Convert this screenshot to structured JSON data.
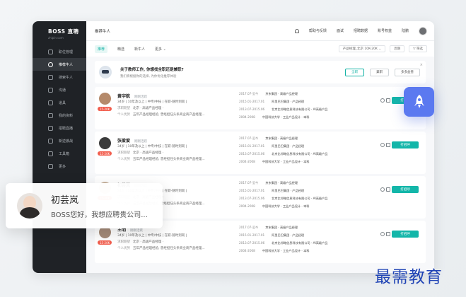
{
  "sidebar": {
    "brand": "BOSS 直聘",
    "brand_sub": "zhipin.com",
    "items": [
      {
        "label": "职位管理"
      },
      {
        "label": "推荐牛人"
      },
      {
        "label": "搜索牛人"
      },
      {
        "label": "沟通"
      },
      {
        "label": "道具"
      },
      {
        "label": "我的资料"
      },
      {
        "label": "招聘直播"
      },
      {
        "label": "新逆袭战"
      },
      {
        "label": "工具箱"
      },
      {
        "label": "更多"
      }
    ]
  },
  "topbar": {
    "title": "推荐牛人",
    "links": [
      "帮助与反馈",
      "面试",
      "招聘数据",
      "账号权益",
      "陆鹏"
    ]
  },
  "tabs": [
    "推荐",
    "精选",
    "新牛人",
    "更多"
  ],
  "filters": {
    "job": "产品经理_北京 10K-20K",
    "b2": "近期",
    "b3": "筛选"
  },
  "banner": {
    "question": "关于教师工作, 你想找全职还是兼职?",
    "sub": "我们将根据你的选择, 为你优化推荐体验",
    "btn_full": "全职",
    "btn_part": "兼职",
    "btn_all": "多多益善",
    "close": "×"
  },
  "candidates": [
    {
      "name": "黄宇航",
      "active": "刚刚活跃",
      "salary": "15-20K",
      "row1": [
        "34岁",
        "10年及以上",
        "中专/中技",
        "在职-随时到岗"
      ],
      "k2": "求职期望",
      "row2": [
        "北京",
        "高级产品经理"
      ],
      "k3": "个人优势",
      "row3": "五年产品经理经验, 曾经担任头条商业商产品经理...",
      "exp": [
        [
          "2017.07-至今",
          "京东集团 · 高级产品经理"
        ],
        [
          "2015.01-2017.01",
          "阿里巴巴集团 · 产品经理"
        ],
        [
          "2013.07-2015.06",
          "北京比邻略信息科技有限公司 · AI高级产品"
        ],
        [
          "2004-2008",
          "中国科技大学 · 工业产品设计 · 本科"
        ]
      ],
      "cta": "打招呼"
    },
    {
      "name": "张爱爱",
      "active": "刚刚活跃",
      "salary": "15-20K",
      "row1": [
        "34岁",
        "10年及以上",
        "中专/中技",
        "在职-随时到岗"
      ],
      "k2": "求职期望",
      "row2": [
        "北京",
        "高级产品经理"
      ],
      "k3": "个人优势",
      "row3": "五年产品经理经验, 曾经担任头条商业商产品经理...",
      "exp": [
        [
          "2017.07-至今",
          "京东集团 · 高级产品经理"
        ],
        [
          "2015.01-2017.01",
          "阿里巴巴集团 · 产品经理"
        ],
        [
          "2013.07-2015.06",
          "北京比邻略信息科技有限公司 · AI高级产品"
        ],
        [
          "2004-2008",
          "中国科技大学 · 工业产品设计 · 本科"
        ]
      ],
      "cta": "打招呼"
    },
    {
      "name": "初芸岚",
      "active": "刚刚活跃",
      "salary": "15-20K",
      "row1": [
        "34岁",
        "10年及以上",
        "中专/中技",
        "在职-随时到岗"
      ],
      "k2": "求职期望",
      "row2": [
        "北京",
        "高级产品经理"
      ],
      "k3": "个人优势",
      "row3": "五年产品经理经验, 曾经担任头条商业商产品经理...",
      "exp": [
        [
          "2017.07-至今",
          "京东集团 · 高级产品经理"
        ],
        [
          "2015.01-2017.01",
          "阿里巴巴集团 · 产品经理"
        ],
        [
          "2013.07-2015.06",
          "北京比邻略信息科技有限公司 · AI高级产品"
        ],
        [
          "2004-2008",
          "中国科技大学 · 工业产品设计 · 本科"
        ]
      ],
      "cta": "打招呼"
    },
    {
      "name": "王明",
      "active": "刚刚活跃",
      "salary": "15-20K",
      "row1": [
        "34岁",
        "10年及以上",
        "中专/中技",
        "在职-随时到岗"
      ],
      "k2": "求职期望",
      "row2": [
        "北京",
        "高级产品经理"
      ],
      "k3": "个人优势",
      "row3": "五年产品经理经验, 曾经担任头条商业商产品经理...",
      "exp": [
        [
          "2017.07-至今",
          "京东集团 · 高级产品经理"
        ],
        [
          "2015.01-2017.01",
          "阿里巴巴集团 · 产品经理"
        ],
        [
          "2013.07-2015.06",
          "北京比邻略信息科技有限公司 · AI高级产品"
        ],
        [
          "2004-2008",
          "中国科技大学 · 工业产品设计 · 本科"
        ]
      ],
      "cta": "打招呼"
    }
  ],
  "chat": {
    "name": "初芸岚",
    "message": "BOSS您好，我想应聘贵公司..."
  },
  "watermark": "最需教育",
  "colors": {
    "accent": "#13b6a9",
    "sidebar": "#1f2226",
    "salary": "#f25d4d",
    "badge": "#5b79f0"
  }
}
